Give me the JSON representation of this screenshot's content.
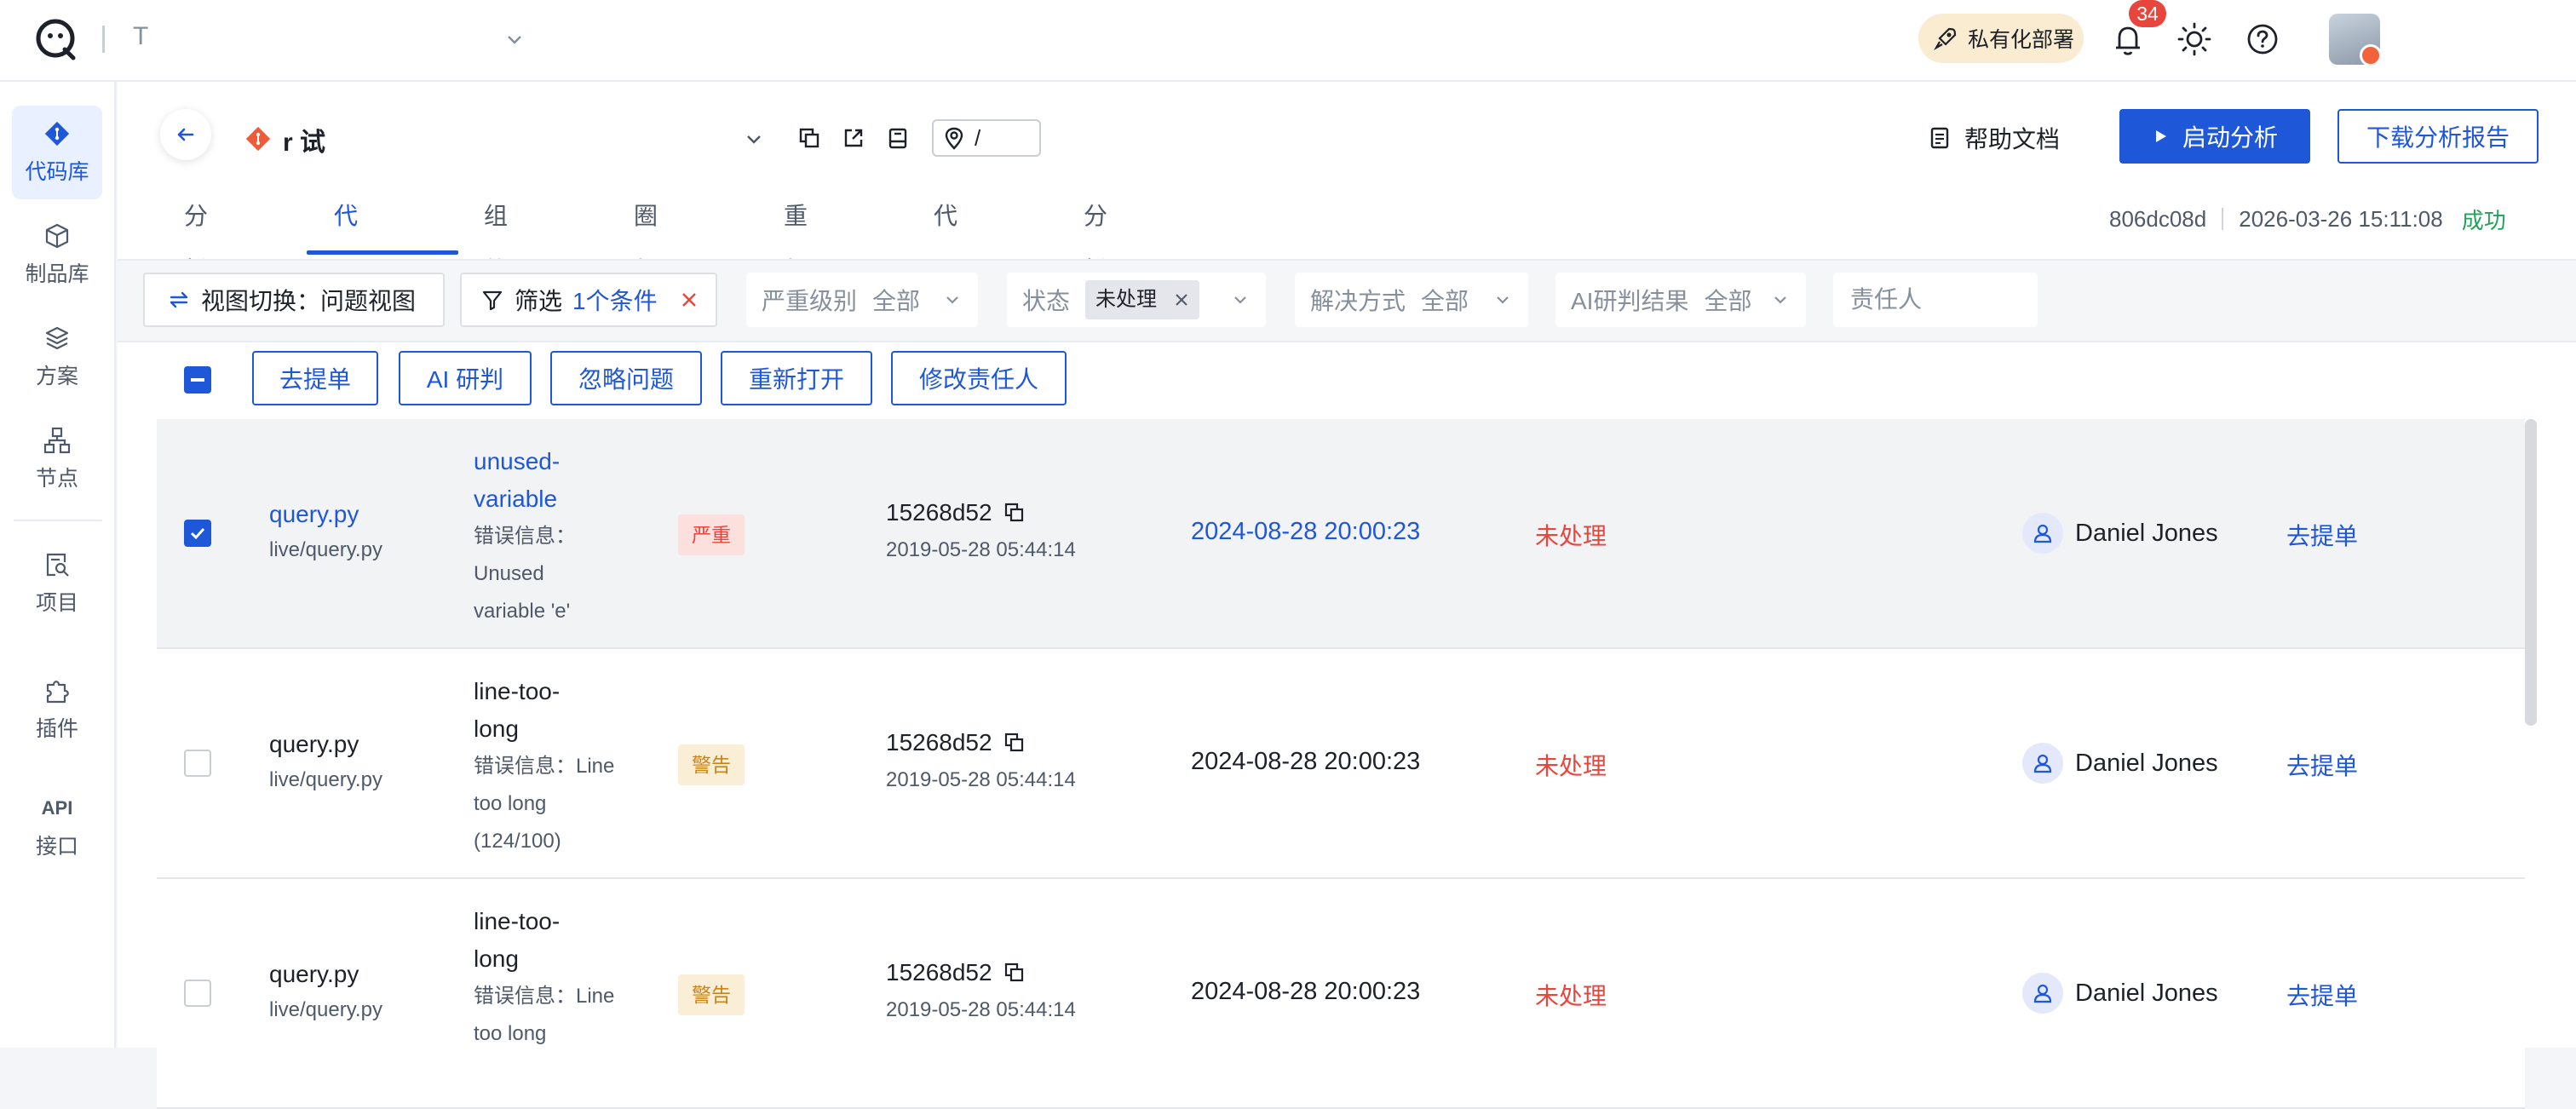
{
  "topbar": {
    "team_name": "T",
    "deploy_pill": "私有化部署",
    "notification_count": "34"
  },
  "sidebar": {
    "items": [
      {
        "label": "代码库",
        "icon": "git-icon",
        "active": true
      },
      {
        "label": "制品库",
        "icon": "package-icon"
      },
      {
        "label": "方案",
        "icon": "layers-icon"
      },
      {
        "label": "节点",
        "icon": "nodes-icon"
      },
      {
        "label": "项目",
        "icon": "project-search-icon"
      },
      {
        "label": "插件",
        "icon": "puzzle-icon"
      },
      {
        "label": "接口",
        "icon": "api-icon",
        "icon_text": "API"
      }
    ]
  },
  "repo": {
    "name": "r                         试",
    "path": "/"
  },
  "header_actions": {
    "help": "帮助文档",
    "start": "启动分析",
    "download": "下载分析报告"
  },
  "tabs": [
    "分析概览",
    "代码检查",
    "组件成分",
    "圈复杂度",
    "重复代码",
    "代码统计",
    "分析历史"
  ],
  "active_tab": "代码检查",
  "commit_meta": {
    "hash": "806dc08d",
    "time": "2026-03-26 15:11:08",
    "status": "成功"
  },
  "filters": {
    "view_switch": "视图切换：问题视图",
    "filter_label": "筛选",
    "filter_count": "1个条件",
    "severity_label": "严重级别",
    "severity_value": "全部",
    "status_label": "状态",
    "status_tag": "未处理",
    "resolution_label": "解决方式",
    "resolution_value": "全部",
    "ai_label": "AI研判结果",
    "ai_value": "全部",
    "owner_placeholder": "责任人"
  },
  "bulk_actions": [
    "去提单",
    "AI 研判",
    "忽略问题",
    "重新打开",
    "修改责任人"
  ],
  "rows": [
    {
      "file": "query.py",
      "path": "live/query.py",
      "rule_lines": [
        "unused-",
        "variable"
      ],
      "msg_lines": [
        "错误信息：",
        "Unused",
        "variable 'e'"
      ],
      "severity": "严重",
      "commit": "15268d52",
      "commit_date": "2019-05-28 05:44:14",
      "found": "2024-08-28 20:00:23",
      "status": "未处理",
      "owner": "Daniel Jones",
      "action": "去提单"
    },
    {
      "file": "query.py",
      "path": "live/query.py",
      "rule_lines": [
        "line-too-",
        "long"
      ],
      "msg_lines": [
        "错误信息：Line",
        "too long",
        "(124/100)"
      ],
      "severity": "警告",
      "commit": "15268d52",
      "commit_date": "2019-05-28 05:44:14",
      "found": "2024-08-28 20:00:23",
      "status": "未处理",
      "owner": "Daniel Jones",
      "action": "去提单"
    },
    {
      "file": "query.py",
      "path": "live/query.py",
      "rule_lines": [
        "line-too-",
        "long"
      ],
      "msg_lines": [
        "错误信息：Line",
        "too long"
      ],
      "severity": "警告",
      "commit": "15268d52",
      "commit_date": "2019-05-28 05:44:14",
      "found": "2024-08-28 20:00:23",
      "status": "未处理",
      "owner": "Daniel Jones",
      "action": "去提单"
    }
  ],
  "colors": {
    "accent": "#1f57d9",
    "danger": "#e8453c",
    "success": "#23a35a",
    "warning": "#c8841b"
  }
}
